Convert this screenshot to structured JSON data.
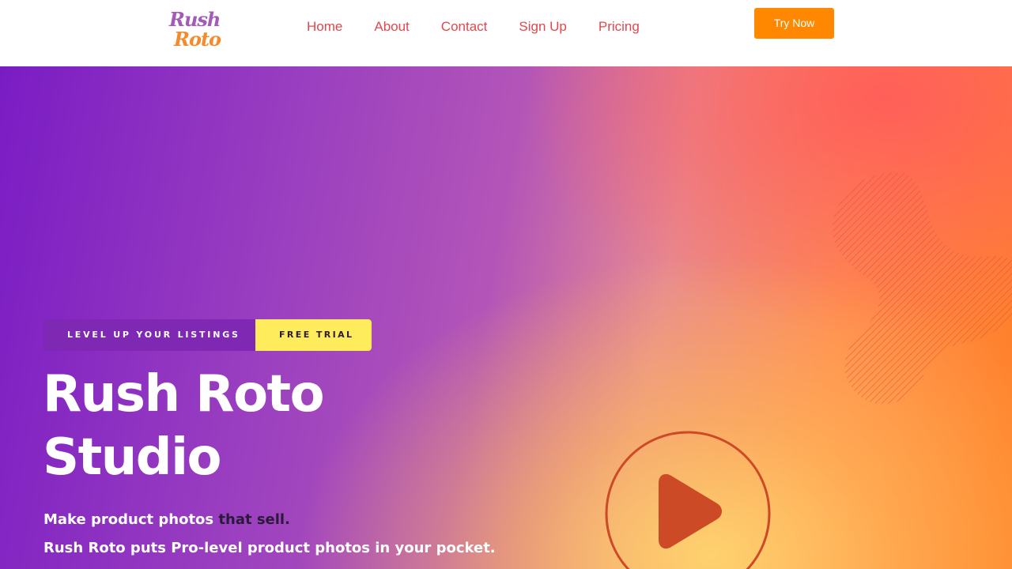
{
  "logo": {
    "line1": "Rush",
    "line2": "Roto"
  },
  "nav": {
    "items": [
      {
        "label": "Home"
      },
      {
        "label": "About"
      },
      {
        "label": "Contact"
      },
      {
        "label": "Sign Up"
      },
      {
        "label": "Pricing"
      }
    ],
    "cta_label": "Try Now"
  },
  "hero": {
    "pill_left": "LEVEL UP YOUR LISTINGS",
    "pill_right": "FREE TRIAL",
    "title_line1": "Rush Roto",
    "title_line2": "Studio",
    "subtitle_main": "Make product photos ",
    "subtitle_highlight": "that sell.",
    "description": "Rush Roto puts Pro-level product photos in your pocket."
  },
  "colors": {
    "nav_link": "#e0484f",
    "cta_button": "#ff8800",
    "pill_left_bg": "#7e28b4",
    "pill_right_bg": "#ffec5c",
    "play_icon": "#cc4a26"
  },
  "icons": {
    "play": "play-icon",
    "decor": "hatched-blob-shape"
  }
}
